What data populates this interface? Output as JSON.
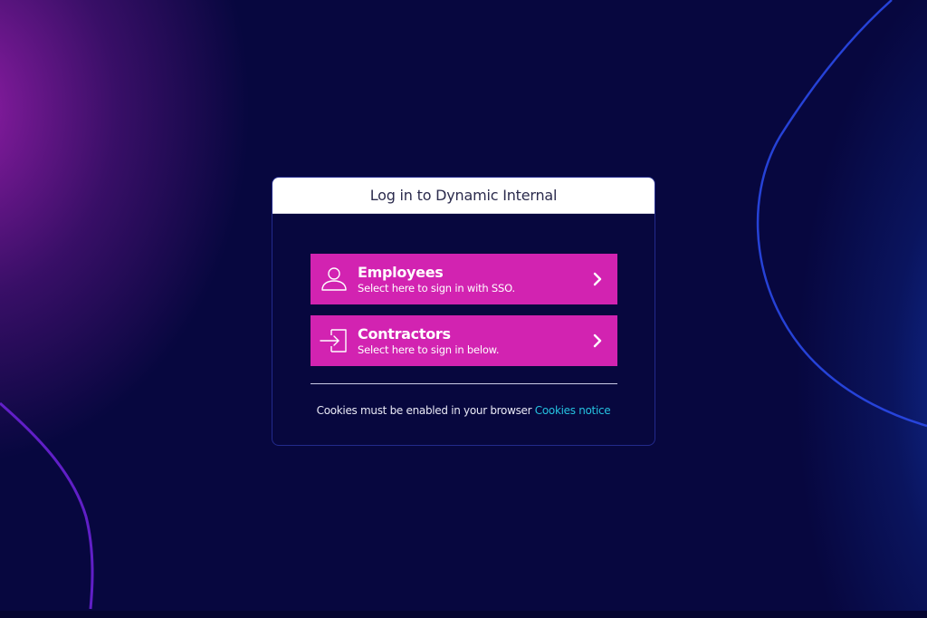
{
  "login": {
    "title": "Log in to Dynamic Internal",
    "options": [
      {
        "label": "Employees",
        "description": "Select here to sign in with SSO.",
        "icon": "user-icon"
      },
      {
        "label": "Contractors",
        "description": "Select here to sign in below.",
        "icon": "sign-in-icon"
      }
    ],
    "cookies": {
      "message": "Cookies must be enabled in your browser",
      "link_label": "Cookies notice"
    }
  },
  "colors": {
    "background": "#07073f",
    "button": "#d223b1",
    "link": "#25c2e0",
    "header_background": "#ffffff"
  }
}
